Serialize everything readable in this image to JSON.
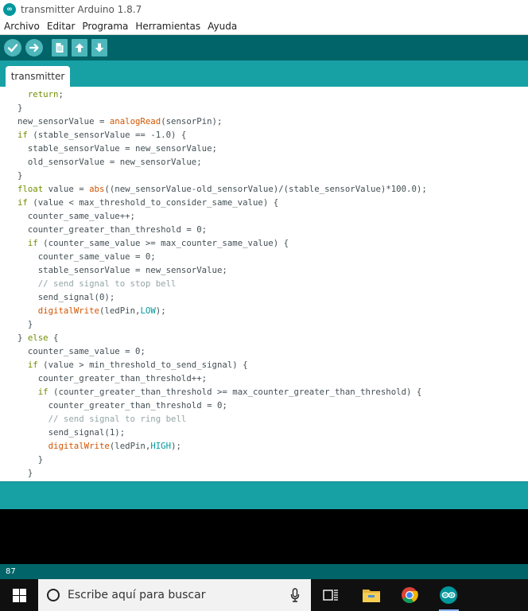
{
  "window": {
    "title": "transmitter Arduino 1.8.7"
  },
  "menu": [
    "Archivo",
    "Editar",
    "Programa",
    "Herramientas",
    "Ayuda"
  ],
  "toolbar": {
    "buttons": [
      "verify-icon",
      "upload-icon",
      "new-icon",
      "open-icon",
      "save-icon"
    ]
  },
  "tab": {
    "label": "transmitter"
  },
  "editor": {
    "lines": [
      [
        {
          "t": "  "
        },
        {
          "t": "return",
          "c": "kw"
        },
        {
          "t": ";"
        }
      ],
      [
        {
          "t": "}"
        }
      ],
      [
        {
          "t": "new_sensorValue = "
        },
        {
          "t": "analogRead",
          "c": "fn"
        },
        {
          "t": "(sensorPin);"
        }
      ],
      [
        {
          "t": "if",
          "c": "kw"
        },
        {
          "t": " (stable_sensorValue == -1.0) {"
        }
      ],
      [
        {
          "t": "  stable_sensorValue = new_sensorValue;"
        }
      ],
      [
        {
          "t": "  old_sensorValue = new_sensorValue;"
        }
      ],
      [
        {
          "t": "}"
        }
      ],
      [
        {
          "t": "float",
          "c": "kw"
        },
        {
          "t": " value = "
        },
        {
          "t": "abs",
          "c": "fn"
        },
        {
          "t": "((new_sensorValue-old_sensorValue)/(stable_sensorValue)*100.0);"
        }
      ],
      [
        {
          "t": "if",
          "c": "kw"
        },
        {
          "t": " (value < max_threshold_to_consider_same_value) {"
        }
      ],
      [
        {
          "t": "  counter_same_value++;"
        }
      ],
      [
        {
          "t": "  counter_greater_than_threshold = 0;"
        }
      ],
      [
        {
          "t": "  "
        },
        {
          "t": "if",
          "c": "kw"
        },
        {
          "t": " (counter_same_value >= max_counter_same_value) {"
        }
      ],
      [
        {
          "t": "    counter_same_value = 0;"
        }
      ],
      [
        {
          "t": "    stable_sensorValue = new_sensorValue;"
        }
      ],
      [
        {
          "t": "    // send signal to stop bell",
          "c": "cm"
        }
      ],
      [
        {
          "t": "    send_signal(0);"
        }
      ],
      [
        {
          "t": "    "
        },
        {
          "t": "digitalWrite",
          "c": "fn"
        },
        {
          "t": "(ledPin,"
        },
        {
          "t": "LOW",
          "c": "cst"
        },
        {
          "t": ");"
        }
      ],
      [
        {
          "t": "  }"
        }
      ],
      [
        {
          "t": "} "
        },
        {
          "t": "else",
          "c": "kw"
        },
        {
          "t": " {"
        }
      ],
      [
        {
          "t": "  counter_same_value = 0;"
        }
      ],
      [
        {
          "t": "  "
        },
        {
          "t": "if",
          "c": "kw"
        },
        {
          "t": " (value > min_threshold_to_send_signal) {"
        }
      ],
      [
        {
          "t": "    counter_greater_than_threshold++;"
        }
      ],
      [
        {
          "t": "    "
        },
        {
          "t": "if",
          "c": "kw"
        },
        {
          "t": " (counter_greater_than_threshold >= max_counter_greater_than_threshold) {"
        }
      ],
      [
        {
          "t": "      counter_greater_than_threshold = 0;"
        }
      ],
      [
        {
          "t": "      // send signal to ring bell",
          "c": "cm"
        }
      ],
      [
        {
          "t": "      send_signal(1);"
        }
      ],
      [
        {
          "t": "      "
        },
        {
          "t": "digitalWrite",
          "c": "fn"
        },
        {
          "t": "(ledPin,"
        },
        {
          "t": "HIGH",
          "c": "cst"
        },
        {
          "t": ");"
        }
      ],
      [
        {
          "t": "    }"
        }
      ],
      [
        {
          "t": "  }"
        }
      ]
    ]
  },
  "status": {
    "line_number": "87"
  },
  "taskbar": {
    "search_placeholder": "Escribe aquí para buscar",
    "apps": [
      "task-view-icon",
      "file-explorer-icon",
      "chrome-icon",
      "arduino-icon"
    ]
  },
  "colors": {
    "teal_dark": "#006468",
    "teal": "#17a1a5",
    "keyword": "#728e00",
    "function": "#d35400",
    "constant": "#00979c",
    "comment": "#95a5a6"
  }
}
